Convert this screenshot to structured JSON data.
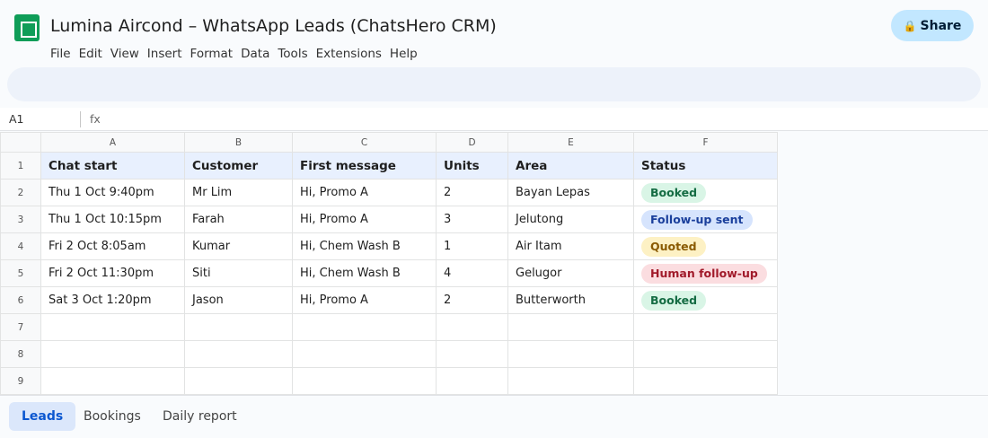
{
  "header": {
    "title": "Lumina Aircond – WhatsApp Leads (ChatsHero CRM)",
    "share_label": "Share",
    "share_icon": "lock-icon",
    "menu": [
      "File",
      "Edit",
      "View",
      "Insert",
      "Format",
      "Data",
      "Tools",
      "Extensions",
      "Help"
    ]
  },
  "formula_bar": {
    "cell_ref": "A1",
    "fx_label": "fx",
    "value": ""
  },
  "sheet": {
    "columns": [
      "A",
      "B",
      "C",
      "D",
      "E",
      "F"
    ],
    "row_numbers": [
      "1",
      "2",
      "3",
      "4",
      "5",
      "6",
      "7",
      "8",
      "9"
    ],
    "headers": [
      "Chat start",
      "Customer",
      "First message",
      "Units",
      "Area",
      "Status"
    ],
    "rows": [
      [
        "Thu 1 Oct 9:40pm",
        "Mr Lim",
        "Hi, Promo A",
        "2",
        "Bayan Lepas",
        "Booked"
      ],
      [
        "Thu 1 Oct 10:15pm",
        "Farah",
        "Hi, Promo A",
        "3",
        "Jelutong",
        "Follow-up sent"
      ],
      [
        "Fri 2 Oct 8:05am",
        "Kumar",
        "Hi, Chem Wash B",
        "1",
        "Air Itam",
        "Quoted"
      ],
      [
        "Fri 2 Oct 11:30pm",
        "Siti",
        "Hi, Chem Wash B",
        "4",
        "Gelugor",
        "Human follow-up"
      ],
      [
        "Sat 3 Oct 1:20pm",
        "Jason",
        "Hi, Promo A",
        "2",
        "Butterworth",
        "Booked"
      ]
    ],
    "status_colors": {
      "Booked": "#146c43",
      "Follow-up sent": "#1a3f9c",
      "Quoted": "#8a5a00",
      "Human follow-up": "#a11a2a"
    }
  },
  "tabs": {
    "items": [
      "Leads",
      "Bookings",
      "Daily report"
    ],
    "active": "Leads"
  }
}
